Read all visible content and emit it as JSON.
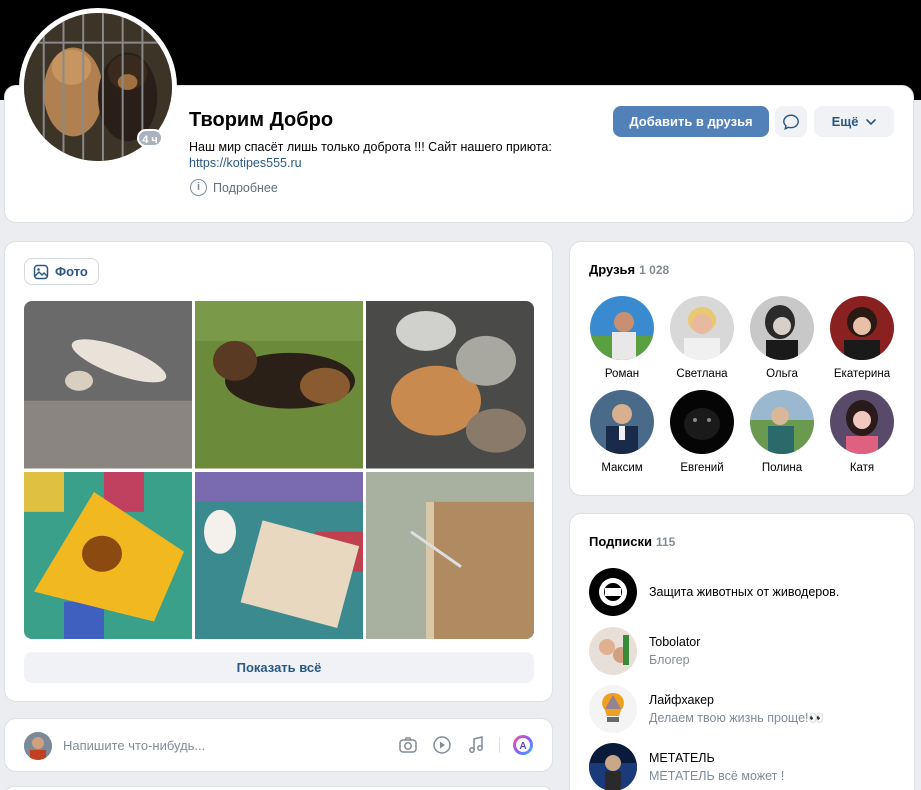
{
  "profile": {
    "name": "Творим Добро",
    "status_line": "Наш мир спасёт лишь только доброта !!! Сайт нашего приюта:",
    "status_link": "https://kotipes555.ru",
    "more_info_label": "Подробнее",
    "avatar_badge": "4 ч",
    "add_friend_label": "Добавить в друзья",
    "more_label": "Ещё"
  },
  "photos": {
    "tab_label": "Фото",
    "show_all_label": "Показать всё"
  },
  "composer": {
    "placeholder": "Напишите что-нибудь..."
  },
  "friends": {
    "title": "Друзья",
    "count": "1 028",
    "items": [
      {
        "name": "Роман"
      },
      {
        "name": "Светлана"
      },
      {
        "name": "Ольга"
      },
      {
        "name": "Екатерина"
      },
      {
        "name": "Максим"
      },
      {
        "name": "Евгений"
      },
      {
        "name": "Полина"
      },
      {
        "name": "Катя"
      }
    ]
  },
  "subscriptions": {
    "title": "Подписки",
    "count": "115",
    "items": [
      {
        "name": "Защита животных от живодеров.",
        "desc": ""
      },
      {
        "name": "Tobolator",
        "desc": "Блогер"
      },
      {
        "name": "Лайфхакер",
        "desc": "Делаем твою жизнь проще!👀"
      },
      {
        "name": "МЕТАТЕЛЬ",
        "desc": "МЕТАТЕЛЬ всё может !"
      }
    ]
  },
  "colors": {
    "accent": "#5181b8",
    "link": "#2a5885",
    "page_bg": "#ebedf0",
    "muted": "#818c99"
  }
}
